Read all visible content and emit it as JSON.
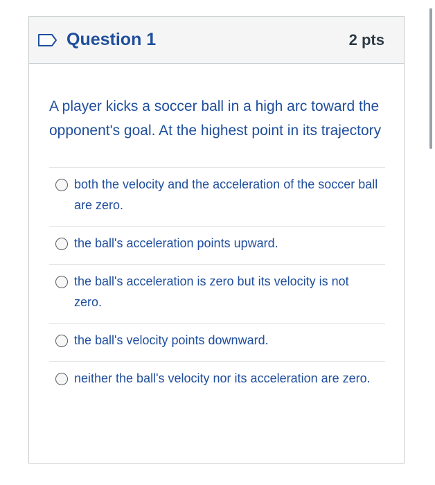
{
  "question": {
    "title": "Question 1",
    "points": "2 pts",
    "text": "A player kicks a soccer ball in a high arc toward the opponent's goal. At the highest point in its trajectory",
    "flag_icon": "flag-outline-icon"
  },
  "answers": [
    {
      "label": "both the velocity and the acceleration of the soccer ball are zero.",
      "selected": false
    },
    {
      "label": "the ball's acceleration points upward.",
      "selected": false
    },
    {
      "label": "the ball's acceleration is zero but its velocity is not zero.",
      "selected": false
    },
    {
      "label": "the ball's velocity points downward.",
      "selected": false
    },
    {
      "label": "neither the ball's velocity nor its acceleration are zero.",
      "selected": false
    }
  ],
  "colors": {
    "accent": "#1f4e9c",
    "header_bg": "#f5f5f5",
    "border": "#c7cdd1",
    "points_text": "#2d3b45"
  }
}
